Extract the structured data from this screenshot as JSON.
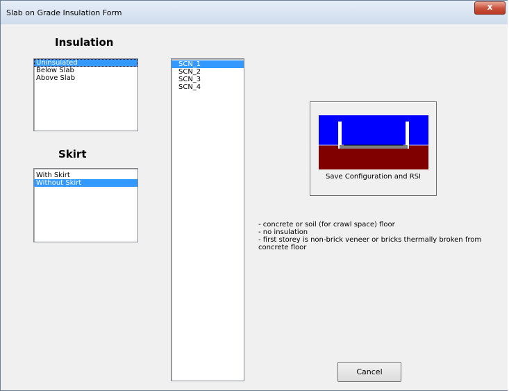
{
  "window": {
    "title": "Slab on Grade Insulation Form",
    "close_label": "x"
  },
  "insulation": {
    "heading": "Insulation",
    "items": [
      "Uninsulated",
      "Below Slab",
      "Above Slab"
    ],
    "selected_index": 0
  },
  "skirt": {
    "heading": "Skirt",
    "items": [
      "With Skirt",
      "Without Skirt"
    ],
    "selected_index": 1
  },
  "scenarios": {
    "items": [
      "SCN_1",
      "SCN_2",
      "SCN_3",
      "SCN_4"
    ],
    "selected_index": 0
  },
  "preview": {
    "button_label": "Save Configuration and RSI",
    "colors": {
      "sky": "#0000ff",
      "soil": "#800000",
      "wall": "#ffffff",
      "slab": "#808080"
    }
  },
  "description": {
    "lines": [
      "- concrete or soil (for crawl space) floor",
      "- no insulation",
      "- first storey is non-brick veneer or bricks thermally broken from concrete floor"
    ]
  },
  "buttons": {
    "cancel_label": "Cancel"
  }
}
